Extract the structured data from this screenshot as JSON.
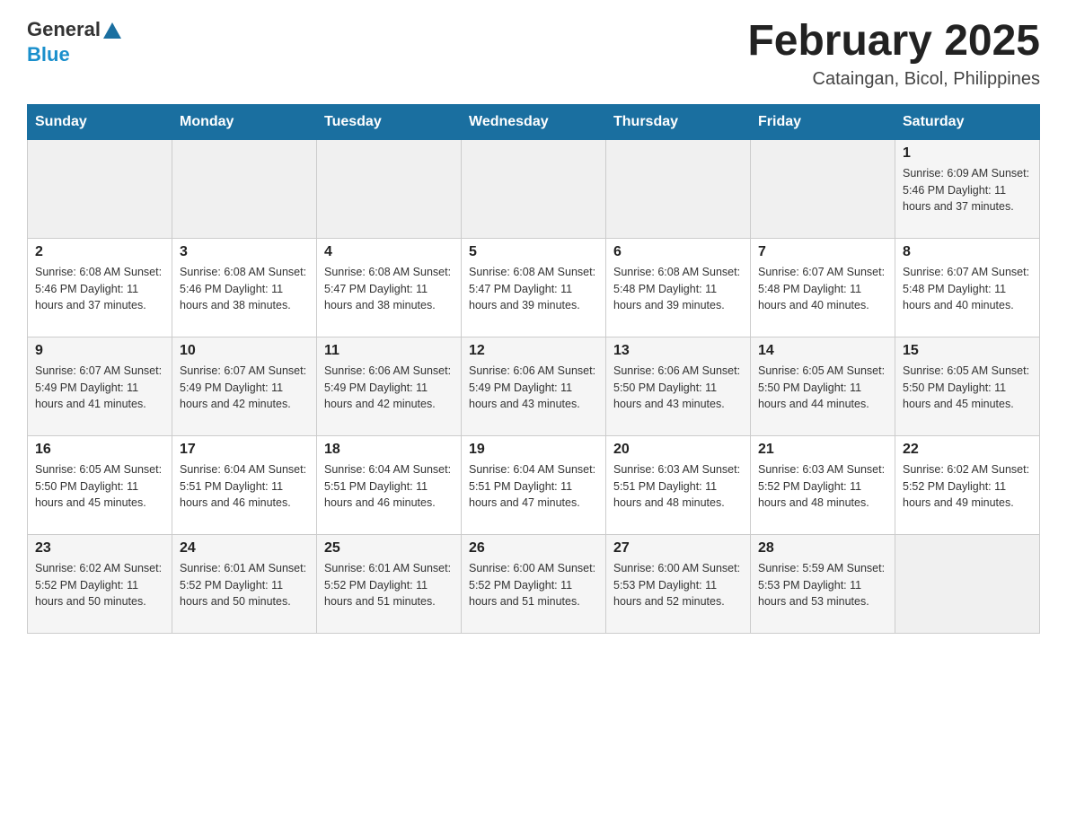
{
  "header": {
    "logo": {
      "general": "General",
      "blue": "Blue"
    },
    "title": "February 2025",
    "location": "Cataingan, Bicol, Philippines"
  },
  "days_of_week": [
    "Sunday",
    "Monday",
    "Tuesday",
    "Wednesday",
    "Thursday",
    "Friday",
    "Saturday"
  ],
  "weeks": [
    [
      {
        "day": "",
        "info": ""
      },
      {
        "day": "",
        "info": ""
      },
      {
        "day": "",
        "info": ""
      },
      {
        "day": "",
        "info": ""
      },
      {
        "day": "",
        "info": ""
      },
      {
        "day": "",
        "info": ""
      },
      {
        "day": "1",
        "info": "Sunrise: 6:09 AM\nSunset: 5:46 PM\nDaylight: 11 hours and 37 minutes."
      }
    ],
    [
      {
        "day": "2",
        "info": "Sunrise: 6:08 AM\nSunset: 5:46 PM\nDaylight: 11 hours and 37 minutes."
      },
      {
        "day": "3",
        "info": "Sunrise: 6:08 AM\nSunset: 5:46 PM\nDaylight: 11 hours and 38 minutes."
      },
      {
        "day": "4",
        "info": "Sunrise: 6:08 AM\nSunset: 5:47 PM\nDaylight: 11 hours and 38 minutes."
      },
      {
        "day": "5",
        "info": "Sunrise: 6:08 AM\nSunset: 5:47 PM\nDaylight: 11 hours and 39 minutes."
      },
      {
        "day": "6",
        "info": "Sunrise: 6:08 AM\nSunset: 5:48 PM\nDaylight: 11 hours and 39 minutes."
      },
      {
        "day": "7",
        "info": "Sunrise: 6:07 AM\nSunset: 5:48 PM\nDaylight: 11 hours and 40 minutes."
      },
      {
        "day": "8",
        "info": "Sunrise: 6:07 AM\nSunset: 5:48 PM\nDaylight: 11 hours and 40 minutes."
      }
    ],
    [
      {
        "day": "9",
        "info": "Sunrise: 6:07 AM\nSunset: 5:49 PM\nDaylight: 11 hours and 41 minutes."
      },
      {
        "day": "10",
        "info": "Sunrise: 6:07 AM\nSunset: 5:49 PM\nDaylight: 11 hours and 42 minutes."
      },
      {
        "day": "11",
        "info": "Sunrise: 6:06 AM\nSunset: 5:49 PM\nDaylight: 11 hours and 42 minutes."
      },
      {
        "day": "12",
        "info": "Sunrise: 6:06 AM\nSunset: 5:49 PM\nDaylight: 11 hours and 43 minutes."
      },
      {
        "day": "13",
        "info": "Sunrise: 6:06 AM\nSunset: 5:50 PM\nDaylight: 11 hours and 43 minutes."
      },
      {
        "day": "14",
        "info": "Sunrise: 6:05 AM\nSunset: 5:50 PM\nDaylight: 11 hours and 44 minutes."
      },
      {
        "day": "15",
        "info": "Sunrise: 6:05 AM\nSunset: 5:50 PM\nDaylight: 11 hours and 45 minutes."
      }
    ],
    [
      {
        "day": "16",
        "info": "Sunrise: 6:05 AM\nSunset: 5:50 PM\nDaylight: 11 hours and 45 minutes."
      },
      {
        "day": "17",
        "info": "Sunrise: 6:04 AM\nSunset: 5:51 PM\nDaylight: 11 hours and 46 minutes."
      },
      {
        "day": "18",
        "info": "Sunrise: 6:04 AM\nSunset: 5:51 PM\nDaylight: 11 hours and 46 minutes."
      },
      {
        "day": "19",
        "info": "Sunrise: 6:04 AM\nSunset: 5:51 PM\nDaylight: 11 hours and 47 minutes."
      },
      {
        "day": "20",
        "info": "Sunrise: 6:03 AM\nSunset: 5:51 PM\nDaylight: 11 hours and 48 minutes."
      },
      {
        "day": "21",
        "info": "Sunrise: 6:03 AM\nSunset: 5:52 PM\nDaylight: 11 hours and 48 minutes."
      },
      {
        "day": "22",
        "info": "Sunrise: 6:02 AM\nSunset: 5:52 PM\nDaylight: 11 hours and 49 minutes."
      }
    ],
    [
      {
        "day": "23",
        "info": "Sunrise: 6:02 AM\nSunset: 5:52 PM\nDaylight: 11 hours and 50 minutes."
      },
      {
        "day": "24",
        "info": "Sunrise: 6:01 AM\nSunset: 5:52 PM\nDaylight: 11 hours and 50 minutes."
      },
      {
        "day": "25",
        "info": "Sunrise: 6:01 AM\nSunset: 5:52 PM\nDaylight: 11 hours and 51 minutes."
      },
      {
        "day": "26",
        "info": "Sunrise: 6:00 AM\nSunset: 5:52 PM\nDaylight: 11 hours and 51 minutes."
      },
      {
        "day": "27",
        "info": "Sunrise: 6:00 AM\nSunset: 5:53 PM\nDaylight: 11 hours and 52 minutes."
      },
      {
        "day": "28",
        "info": "Sunrise: 5:59 AM\nSunset: 5:53 PM\nDaylight: 11 hours and 53 minutes."
      },
      {
        "day": "",
        "info": ""
      }
    ]
  ]
}
